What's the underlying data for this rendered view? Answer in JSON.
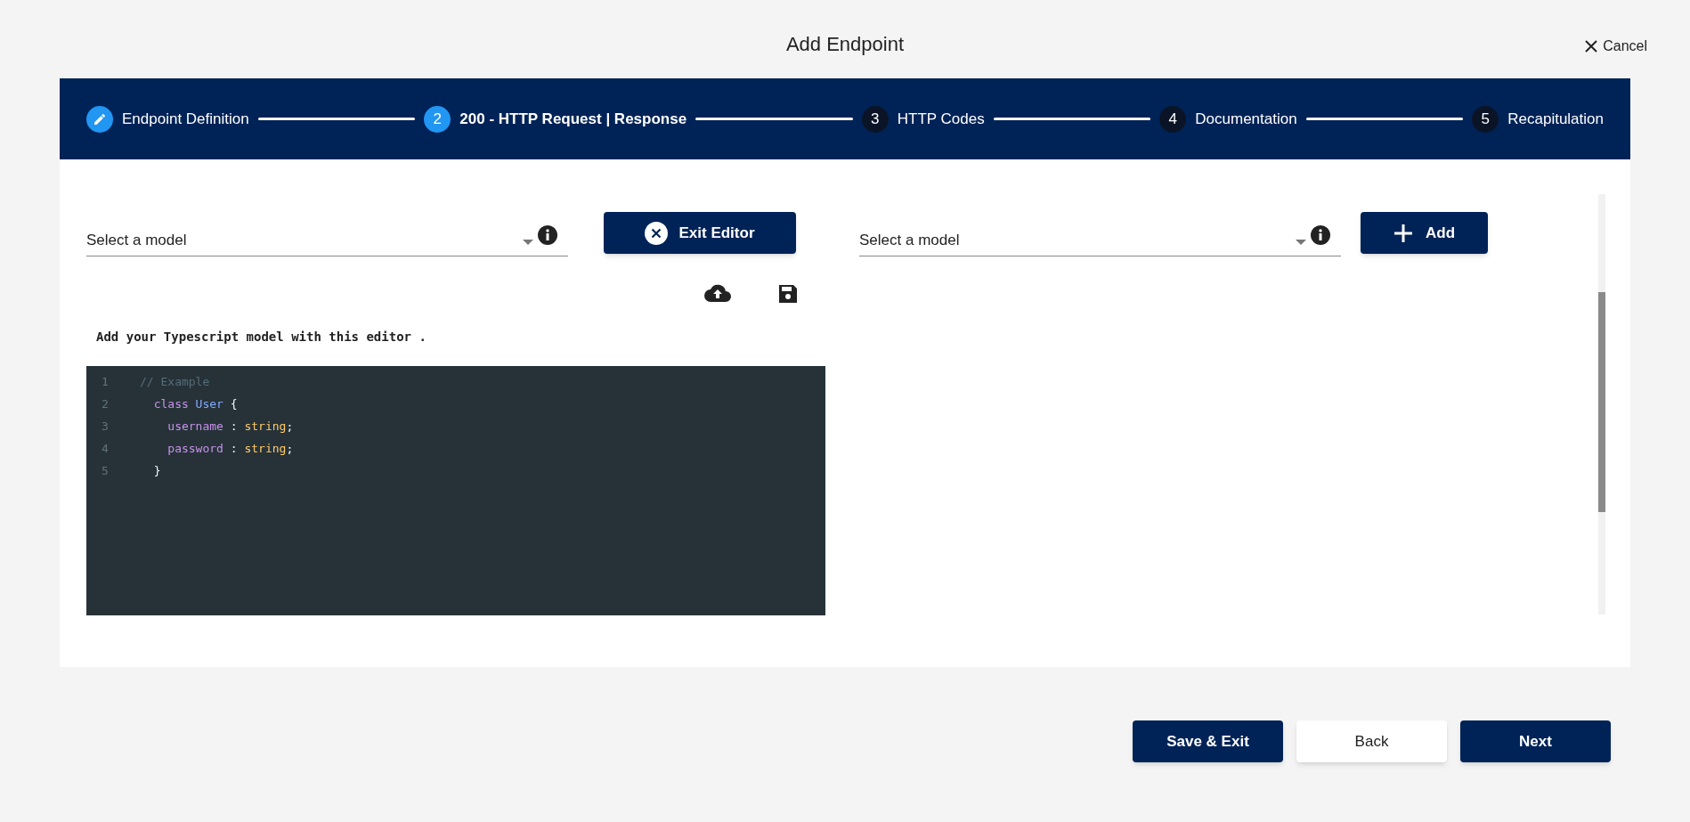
{
  "dialog": {
    "title": "Add Endpoint",
    "cancel": "Cancel"
  },
  "steps": [
    {
      "label": "Endpoint Definition",
      "completed": true,
      "selected": false
    },
    {
      "number": "2",
      "label": "200 - HTTP Request | Response",
      "completed": false,
      "selected": true
    },
    {
      "number": "3",
      "label": "HTTP Codes",
      "completed": false,
      "selected": false
    },
    {
      "number": "4",
      "label": "Documentation",
      "completed": false,
      "selected": false
    },
    {
      "number": "5",
      "label": "Recapitulation",
      "completed": false,
      "selected": false
    }
  ],
  "request": {
    "select": {
      "placeholder": "Select a model"
    },
    "button": {
      "label": "Exit Editor"
    },
    "hint": "Add your Typescript model with this editor .",
    "editor": {
      "lines": [
        {
          "number": "1",
          "tokens": [
            {
              "text": "// Example",
              "kind": "comment"
            }
          ]
        },
        {
          "number": "2",
          "tokens": [
            {
              "text": "  class",
              "kind": "keyword"
            },
            {
              "text": " User",
              "kind": "type"
            },
            {
              "text": " {",
              "kind": "plain"
            }
          ]
        },
        {
          "number": "3",
          "tokens": [
            {
              "text": "    username",
              "kind": "keyword"
            },
            {
              "text": " : ",
              "kind": "plain"
            },
            {
              "text": "string",
              "kind": "builtin"
            },
            {
              "text": ";",
              "kind": "plain"
            }
          ]
        },
        {
          "number": "4",
          "tokens": [
            {
              "text": "    password",
              "kind": "keyword"
            },
            {
              "text": " : ",
              "kind": "plain"
            },
            {
              "text": "string",
              "kind": "builtin"
            },
            {
              "text": ";",
              "kind": "plain"
            }
          ]
        },
        {
          "number": "5",
          "tokens": [
            {
              "text": "  }",
              "kind": "plain"
            }
          ]
        }
      ]
    }
  },
  "response": {
    "select": {
      "placeholder": "Select a model"
    },
    "button": {
      "label": "Add"
    }
  },
  "footer": {
    "buttons": [
      {
        "label": "Save & Exit",
        "kind": "primary"
      },
      {
        "label": "Back",
        "kind": "secondary"
      },
      {
        "label": "Next",
        "kind": "primary"
      }
    ]
  }
}
